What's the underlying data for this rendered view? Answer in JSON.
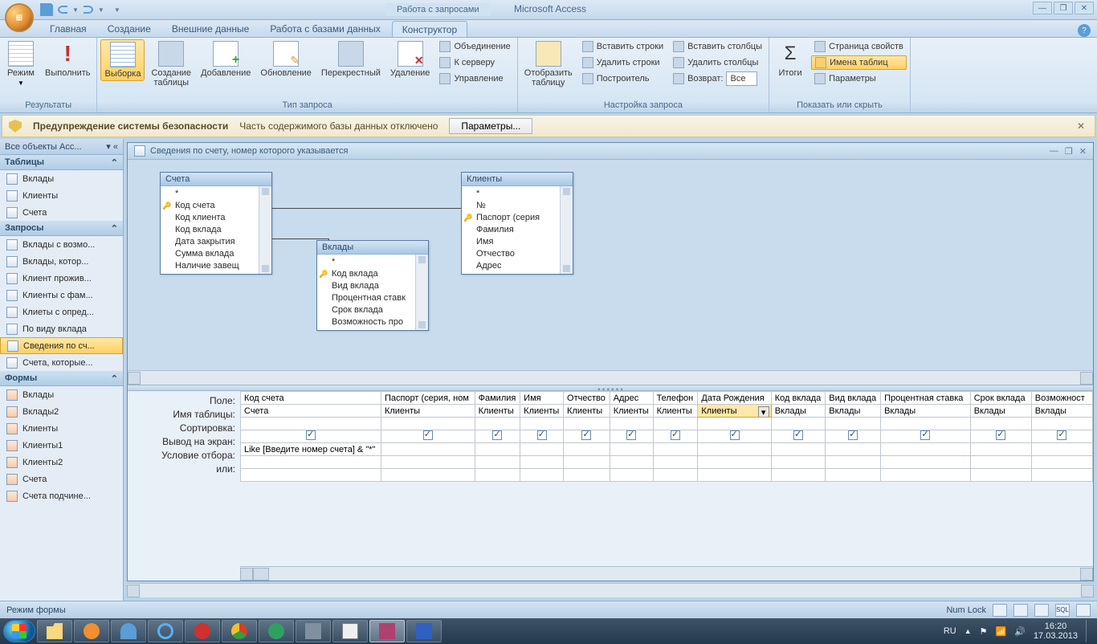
{
  "app": {
    "context_title": "Работа с запросами",
    "name": "Microsoft Access"
  },
  "tabs": {
    "t0": "Главная",
    "t1": "Создание",
    "t2": "Внешние данные",
    "t3": "Работа с базами данных",
    "t4": "Конструктор"
  },
  "ribbon": {
    "g0": {
      "label": "Результаты",
      "btn0": "Режим",
      "btn1": "Выполнить"
    },
    "g1": {
      "label": "Тип запроса",
      "btn0": "Выборка",
      "btn1": "Создание\nтаблицы",
      "btn2": "Добавление",
      "btn3": "Обновление",
      "btn4": "Перекрестный",
      "btn5": "Удаление",
      "s0": "Объединение",
      "s1": "К серверу",
      "s2": "Управление"
    },
    "g2": {
      "label": "Настройка запроса",
      "btn0": "Отобразить\nтаблицу",
      "s0": "Вставить строки",
      "s1": "Удалить строки",
      "s2": "Построитель",
      "s3": "Вставить столбцы",
      "s4": "Удалить столбцы",
      "s5": "Возврат:",
      "combo": "Все"
    },
    "g3": {
      "label": "Показать или скрыть",
      "btn0": "Итоги",
      "s0": "Страница свойств",
      "s1": "Имена таблиц",
      "s2": "Параметры"
    }
  },
  "security": {
    "title": "Предупреждение системы безопасности",
    "msg": "Часть содержимого базы данных отключено",
    "btn": "Параметры..."
  },
  "nav": {
    "header": "Все объекты Acc...",
    "grp_tables": "Таблицы",
    "tables": {
      "i0": "Вклады",
      "i1": "Клиенты",
      "i2": "Счета"
    },
    "grp_queries": "Запросы",
    "queries": {
      "i0": "Вклады с возмо...",
      "i1": "Вклады, котор...",
      "i2": "Клиент прожив...",
      "i3": "Клиенты с фам...",
      "i4": "Клиеты с опред...",
      "i5": "По виду вклада",
      "i6": "Сведения по сч...",
      "i7": "Счета, которые..."
    },
    "grp_forms": "Формы",
    "forms": {
      "i0": "Вклады",
      "i1": "Вклады2",
      "i2": "Клиенты",
      "i3": "Клиенты1",
      "i4": "Клиенты2",
      "i5": "Счета",
      "i6": "Счета подчине..."
    }
  },
  "doc": {
    "title": "Сведения по счету, номер которого указывается"
  },
  "tables_diagram": {
    "t0": {
      "name": "Счета",
      "f0": "*",
      "f1": "Код счета",
      "f2": "Код клиента",
      "f3": "Код вклада",
      "f4": "Дата закрытия",
      "f5": "Сумма вклада",
      "f6": "Наличие завещ"
    },
    "t1": {
      "name": "Вклады",
      "f0": "*",
      "f1": "Код вклада",
      "f2": "Вид вклада",
      "f3": "Процентная ставк",
      "f4": "Срок вклада",
      "f5": "Возможность про"
    },
    "t2": {
      "name": "Клиенты",
      "f0": "*",
      "f1": "№",
      "f2": "Паспорт (серия",
      "f3": "Фамилия",
      "f4": "Имя",
      "f5": "Отчество",
      "f6": "Адрес"
    }
  },
  "grid": {
    "rows": {
      "r0": "Поле:",
      "r1": "Имя таблицы:",
      "r2": "Сортировка:",
      "r3": "Вывод на экран:",
      "r4": "Условие отбора:",
      "r5": "или:"
    },
    "cols": [
      {
        "field": "Код счета",
        "table": "Счета",
        "show": true,
        "crit": "Like [Введите номер счета] & \"*\""
      },
      {
        "field": "Паспорт (серия, ном",
        "table": "Клиенты",
        "show": true,
        "crit": ""
      },
      {
        "field": "Фамилия",
        "table": "Клиенты",
        "show": true,
        "crit": ""
      },
      {
        "field": "Имя",
        "table": "Клиенты",
        "show": true,
        "crit": ""
      },
      {
        "field": "Отчество",
        "table": "Клиенты",
        "show": true,
        "crit": ""
      },
      {
        "field": "Адрес",
        "table": "Клиенты",
        "show": true,
        "crit": ""
      },
      {
        "field": "Телефон",
        "table": "Клиенты",
        "show": true,
        "crit": ""
      },
      {
        "field": "Дата Рождения",
        "table": "Клиенты",
        "show": true,
        "crit": ""
      },
      {
        "field": "Код вклада",
        "table": "Вклады",
        "show": true,
        "crit": ""
      },
      {
        "field": "Вид вклада",
        "table": "Вклады",
        "show": true,
        "crit": ""
      },
      {
        "field": "Процентная ставка",
        "table": "Вклады",
        "show": true,
        "crit": ""
      },
      {
        "field": "Срок вклада",
        "table": "Вклады",
        "show": true,
        "crit": ""
      },
      {
        "field": "Возможност",
        "table": "Вклады",
        "show": true,
        "crit": ""
      }
    ]
  },
  "status": {
    "left": "Режим формы",
    "numlock": "Num Lock"
  },
  "taskbar": {
    "lang": "RU",
    "time": "16:20",
    "date": "17.03.2013"
  }
}
